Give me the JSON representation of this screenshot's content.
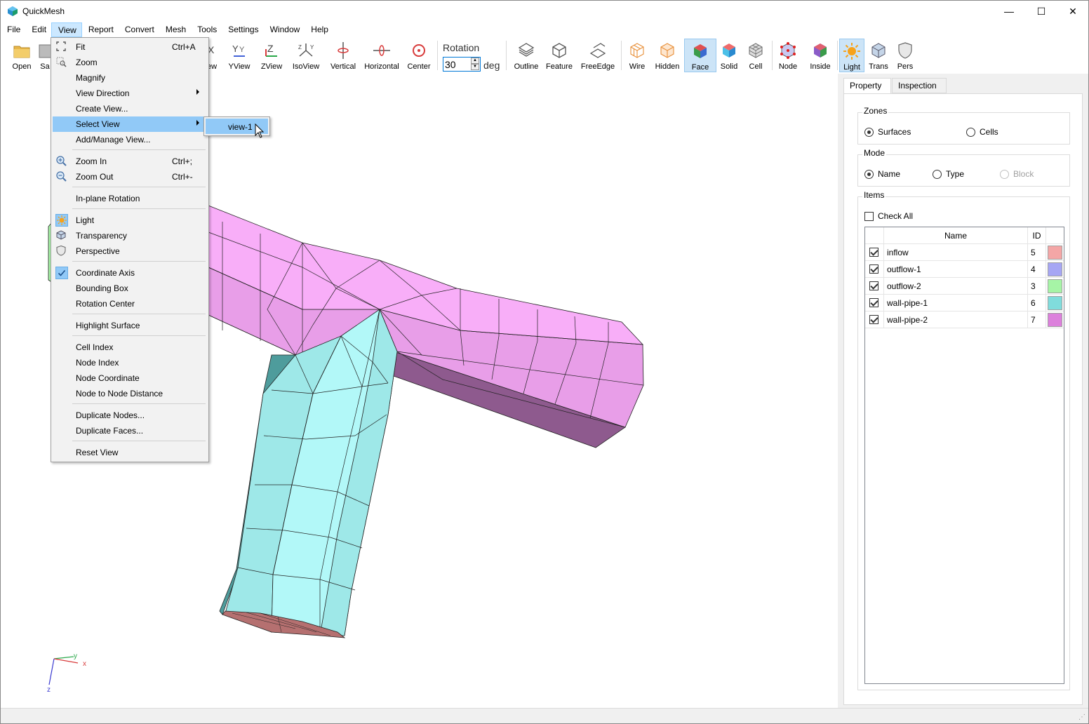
{
  "app": {
    "title": "QuickMesh",
    "minimize_glyph": "—",
    "maximize_glyph": "☐",
    "close_glyph": "✕"
  },
  "menubar": [
    "File",
    "Edit",
    "View",
    "Report",
    "Convert",
    "Mesh",
    "Tools",
    "Settings",
    "Window",
    "Help"
  ],
  "toolbar": {
    "buttons": [
      {
        "name": "open",
        "label": "Open"
      },
      {
        "name": "save",
        "label": "Sa"
      },
      {
        "name": "xview",
        "label": "ew"
      },
      {
        "name": "yview",
        "label": "YView"
      },
      {
        "name": "zview",
        "label": "ZView"
      },
      {
        "name": "isoview",
        "label": "IsoView"
      },
      {
        "name": "vertical",
        "label": "Vertical"
      },
      {
        "name": "horizontal",
        "label": "Horizontal"
      },
      {
        "name": "center",
        "label": "Center"
      },
      {
        "name": "outline",
        "label": "Outline"
      },
      {
        "name": "feature",
        "label": "Feature"
      },
      {
        "name": "freeedge",
        "label": "FreeEdge"
      },
      {
        "name": "wire",
        "label": "Wire"
      },
      {
        "name": "hidden",
        "label": "Hidden"
      },
      {
        "name": "face",
        "label": "Face"
      },
      {
        "name": "solid",
        "label": "Solid"
      },
      {
        "name": "cell",
        "label": "Cell"
      },
      {
        "name": "node",
        "label": "Node"
      },
      {
        "name": "inside",
        "label": "Inside"
      },
      {
        "name": "light",
        "label": "Light"
      },
      {
        "name": "trans",
        "label": "Trans"
      },
      {
        "name": "pers",
        "label": "Pers"
      }
    ],
    "rotation": {
      "label": "Rotation",
      "value": "30",
      "unit": "deg"
    }
  },
  "view_menu": {
    "items": [
      {
        "label": "Fit",
        "shortcut": "Ctrl+A",
        "icon": "fit-icon"
      },
      {
        "label": "Zoom",
        "icon": "zoom-icon"
      },
      {
        "label": "Magnify"
      },
      {
        "label": "View Direction",
        "submenu": true
      },
      {
        "label": "Create View..."
      },
      {
        "label": "Select View",
        "submenu": true,
        "highlighted": true
      },
      {
        "label": "Add/Manage View..."
      },
      {
        "label": "Zoom In",
        "shortcut": "Ctrl+;",
        "icon": "zoom-in-icon"
      },
      {
        "label": "Zoom Out",
        "shortcut": "Ctrl+-",
        "icon": "zoom-out-icon"
      },
      {
        "label": "In-plane Rotation"
      },
      {
        "label": "Light",
        "icon": "light-icon",
        "checked": true
      },
      {
        "label": "Transparency",
        "icon": "transparency-icon"
      },
      {
        "label": "Perspective",
        "icon": "perspective-icon"
      },
      {
        "label": "Coordinate Axis",
        "checked": true
      },
      {
        "label": "Bounding Box"
      },
      {
        "label": "Rotation Center"
      },
      {
        "label": "Highlight Surface"
      },
      {
        "label": "Cell Index"
      },
      {
        "label": "Node Index"
      },
      {
        "label": "Node Coordinate"
      },
      {
        "label": "Node to Node Distance"
      },
      {
        "label": "Duplicate Nodes..."
      },
      {
        "label": "Duplicate Faces..."
      },
      {
        "label": "Reset View"
      }
    ],
    "select_view_submenu": [
      "view-1"
    ]
  },
  "panel": {
    "tabs": [
      "Property",
      "Inspection"
    ],
    "zones": {
      "title": "Zones",
      "options": [
        "Surfaces",
        "Cells"
      ],
      "selected": "Surfaces"
    },
    "mode": {
      "title": "Mode",
      "options": [
        "Name",
        "Type",
        "Block"
      ],
      "selected": "Name",
      "disabled": [
        "Block"
      ]
    },
    "items": {
      "title": "Items",
      "check_all": "Check All",
      "columns": [
        "Name",
        "ID"
      ],
      "rows": [
        {
          "name": "inflow",
          "id": "5",
          "color": "#f4a6a6",
          "checked": true
        },
        {
          "name": "outflow-1",
          "id": "4",
          "color": "#a6a6f4",
          "checked": true
        },
        {
          "name": "outflow-2",
          "id": "3",
          "color": "#a6f4a6",
          "checked": true
        },
        {
          "name": "wall-pipe-1",
          "id": "6",
          "color": "#80dcdc",
          "checked": true
        },
        {
          "name": "wall-pipe-2",
          "id": "7",
          "color": "#dc80dc",
          "checked": true
        }
      ]
    }
  },
  "axis": {
    "x": "x",
    "y": "y",
    "z": "z"
  }
}
